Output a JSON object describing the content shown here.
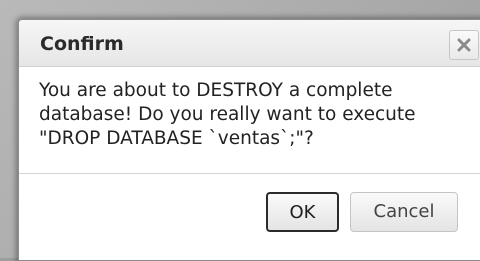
{
  "dialog": {
    "title": "Confirm",
    "close_icon": "close-icon",
    "message_lines": [
      "You are about to DESTROY a complete",
      "database! Do you really want to execute",
      "\"DROP DATABASE `ventas`;\"?"
    ],
    "ok_label": "OK",
    "cancel_label": "Cancel"
  }
}
